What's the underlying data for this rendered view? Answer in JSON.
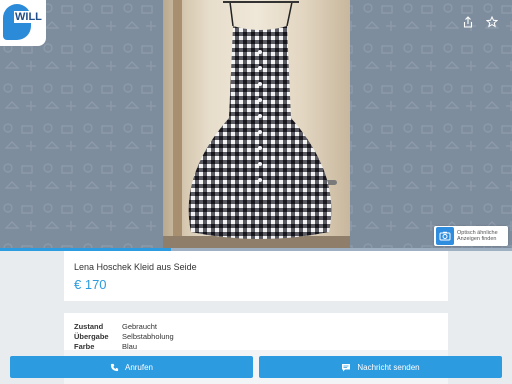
{
  "app": {
    "logo_text": "WILL",
    "brand_color": "#2d9be0"
  },
  "gallery": {
    "photo_position": 1,
    "photo_count": 3,
    "share_icon": "share-icon",
    "favorite_icon": "star-icon",
    "visual_search": {
      "line1": "Optisch ähnliche",
      "line2": "Anzeigen finden"
    }
  },
  "listing": {
    "title": "Lena Hoschek Kleid aus Seide",
    "price": "€ 170"
  },
  "details": [
    {
      "label": "Zustand",
      "value": "Gebraucht"
    },
    {
      "label": "Übergabe",
      "value": "Selbstabholung"
    },
    {
      "label": "Farbe",
      "value": "Blau"
    }
  ],
  "actions": {
    "call_label": "Anrufen",
    "message_label": "Nachricht senden"
  }
}
